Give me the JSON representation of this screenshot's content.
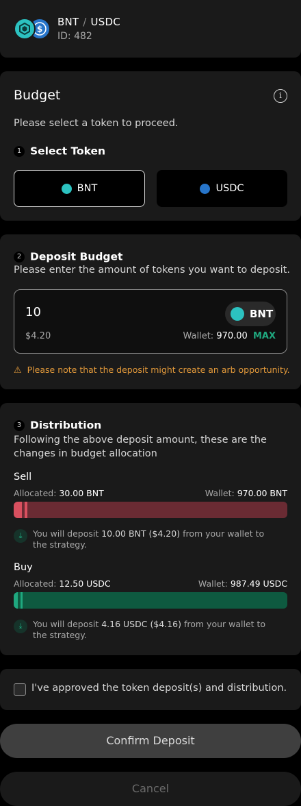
{
  "header": {
    "base_token": "BNT",
    "separator": "/",
    "quote_token": "USDC",
    "id_text": "ID: 482",
    "icons": [
      "bnt-token-icon",
      "usdc-token-icon"
    ]
  },
  "budget": {
    "title": "Budget",
    "subtitle": "Please select a token to proceed.",
    "step_number": "1",
    "step_title": "Select Token",
    "tokens": [
      {
        "label": "BNT",
        "selected": true,
        "color": "#2cc2c0"
      },
      {
        "label": "USDC",
        "selected": false,
        "color": "#2775ca"
      }
    ]
  },
  "deposit": {
    "step_number": "2",
    "step_title": "Deposit Budget",
    "description": "Please enter the amount of tokens you want to deposit.",
    "amount": "10",
    "token": "BNT",
    "fiat_value": "$4.20",
    "wallet_label": "Wallet:",
    "wallet_value": "970.00",
    "max_label": "MAX",
    "warning": "Please note that the deposit might create an arb opportunity."
  },
  "distribution": {
    "step_number": "3",
    "step_title": "Distribution",
    "description": "Following the above deposit amount, these are the changes in budget allocation",
    "sell": {
      "title": "Sell",
      "allocated_label": "Allocated:",
      "allocated_value": "30.00 BNT",
      "wallet_label": "Wallet:",
      "wallet_value": "970.00 BNT",
      "allocated_fraction": 0.03,
      "deposit_fraction": 0.01,
      "note_prefix": "You will deposit",
      "note_amount": "10.00 BNT",
      "note_fiat": "($4.20)",
      "note_suffix": "from your wallet to the strategy.",
      "color": "#d8505f",
      "bg_color": "#6a2b33"
    },
    "buy": {
      "title": "Buy",
      "allocated_label": "Allocated:",
      "allocated_value": "12.50 USDC",
      "wallet_label": "Wallet:",
      "wallet_value": "987.49 USDC",
      "allocated_fraction": 0.0125,
      "deposit_fraction": 0.004,
      "note_prefix": "You will deposit",
      "note_amount": "4.16 USDC",
      "note_fiat": "($4.16)",
      "note_suffix": "from your wallet to the strategy.",
      "color": "#1fa87f",
      "bg_color": "#0e5a40"
    }
  },
  "approval": {
    "label": "I've approved the token deposit(s) and distribution.",
    "checked": false
  },
  "actions": {
    "confirm_label": "Confirm Deposit",
    "cancel_label": "Cancel"
  }
}
